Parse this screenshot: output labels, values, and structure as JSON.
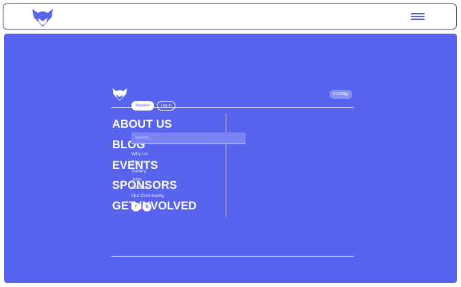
{
  "header": {
    "logo_icon": "fox-head-logo-icon",
    "menu_icon": "hamburger-menu-icon",
    "brand_color": "#5a64ea"
  },
  "menu": {
    "background": "#5864ee",
    "close_label": "CLOSE",
    "close_icon": "close-x-icon",
    "nav_items": [
      "ABOUT US",
      "BLOG",
      "EVENTS",
      "SPONSORS",
      "GET INVOLVED"
    ],
    "auth": {
      "register_label": "Register",
      "login_label": "Log in"
    },
    "search": {
      "placeholder": "Search...",
      "value": ""
    },
    "links": [
      "Why Us",
      "Clients",
      "Gallery",
      "Jobs",
      "Contacts",
      "Our Community"
    ],
    "social": [
      {
        "icon": "facebook-icon",
        "glyph": "f"
      },
      {
        "icon": "x-twitter-icon",
        "glyph": "𝕏"
      }
    ]
  }
}
